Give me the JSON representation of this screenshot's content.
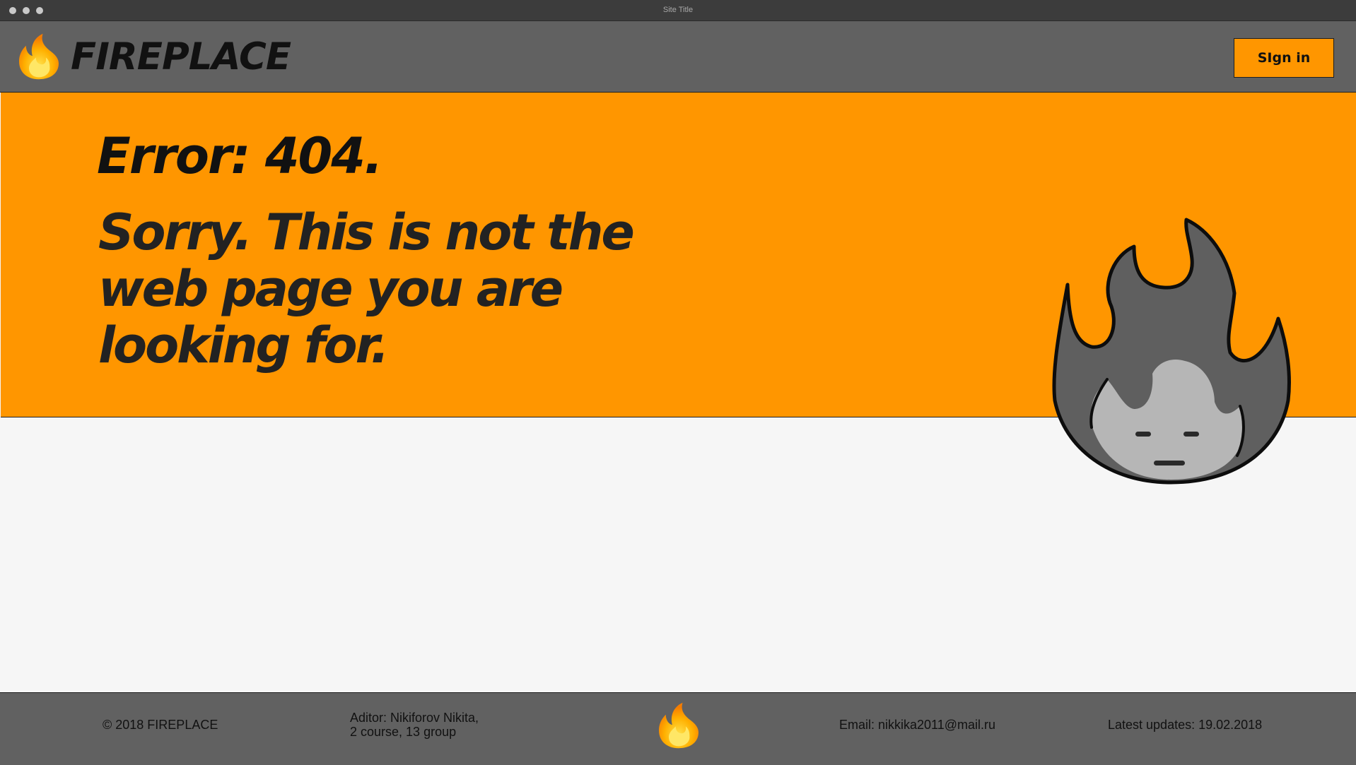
{
  "window": {
    "title": "Site Title"
  },
  "header": {
    "brand": "FIREPLACE",
    "signin_label": "SIgn in",
    "logo_icon": "fire-icon"
  },
  "hero": {
    "error_title": "Error: 404.",
    "message": "Sorry.  This is not the web page you are looking for.",
    "mascot_icon": "sad-fire-face-icon"
  },
  "footer": {
    "copyright": "© 2018 FIREPLACE",
    "editor_line1": "Aditor: Nikiforov Nikita,",
    "editor_line2": "2 course, 13 group",
    "email": "Email: nikkika2011@mail.ru",
    "updates": "Latest updates: 19.02.2018",
    "logo_icon": "fire-icon"
  },
  "colors": {
    "accent": "#ff9600",
    "header_bg": "#616161",
    "page_bg": "#f6f6f6",
    "text": "#111111"
  }
}
